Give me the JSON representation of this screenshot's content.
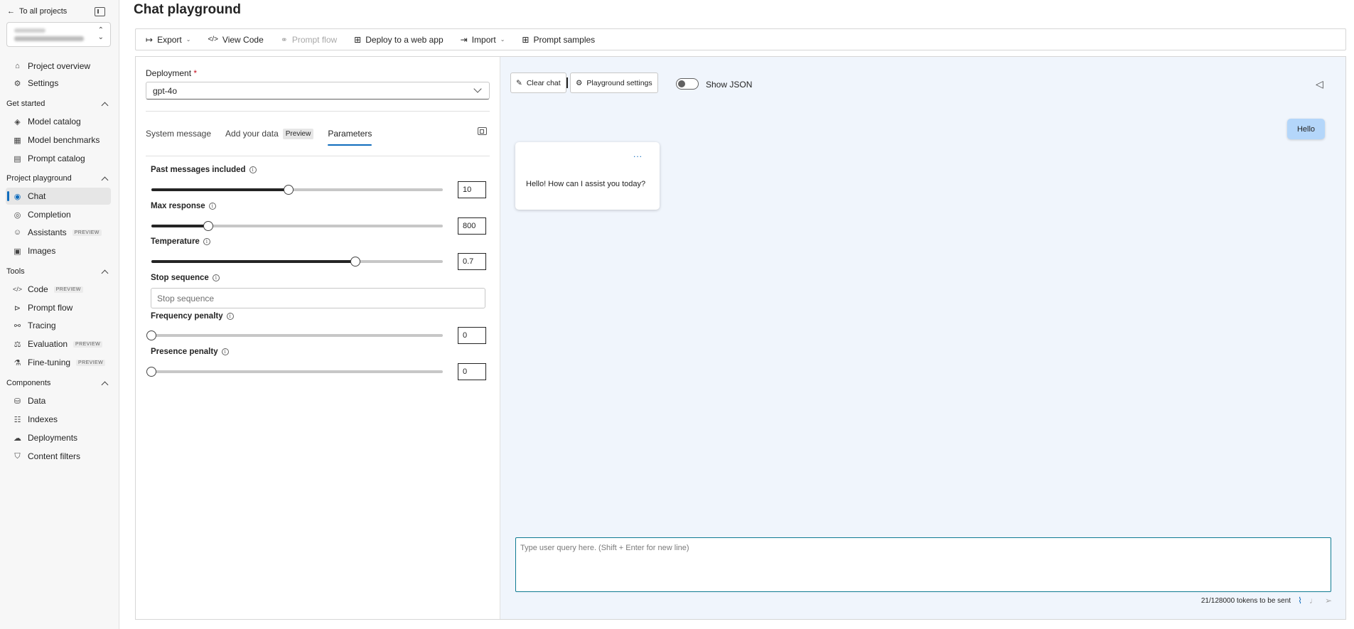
{
  "sidebar": {
    "back_label": "To all projects",
    "nav_top": [
      {
        "label": "Project overview",
        "icon": "⌂"
      },
      {
        "label": "Settings",
        "icon": "⚙"
      }
    ],
    "sections": [
      {
        "title": "Get started",
        "items": [
          {
            "label": "Model catalog",
            "icon": "◈"
          },
          {
            "label": "Model benchmarks",
            "icon": "▦"
          },
          {
            "label": "Prompt catalog",
            "icon": "▤"
          }
        ]
      },
      {
        "title": "Project playground",
        "items": [
          {
            "label": "Chat",
            "icon": "◉",
            "active": true
          },
          {
            "label": "Completion",
            "icon": "◎"
          },
          {
            "label": "Assistants",
            "icon": "☺",
            "badge": "PREVIEW"
          },
          {
            "label": "Images",
            "icon": "▣"
          }
        ]
      },
      {
        "title": "Tools",
        "items": [
          {
            "label": "Code",
            "icon": "</>",
            "badge": "PREVIEW"
          },
          {
            "label": "Prompt flow",
            "icon": "⊳"
          },
          {
            "label": "Tracing",
            "icon": "⚯"
          },
          {
            "label": "Evaluation",
            "icon": "⚖",
            "badge": "PREVIEW"
          },
          {
            "label": "Fine-tuning",
            "icon": "⚗",
            "badge": "PREVIEW"
          }
        ]
      },
      {
        "title": "Components",
        "items": [
          {
            "label": "Data",
            "icon": "⛁"
          },
          {
            "label": "Indexes",
            "icon": "☷"
          },
          {
            "label": "Deployments",
            "icon": "☁"
          },
          {
            "label": "Content filters",
            "icon": "⛉"
          }
        ]
      }
    ]
  },
  "page": {
    "title": "Chat playground"
  },
  "toolbar": {
    "export": "Export",
    "view_code": "View Code",
    "prompt_flow": "Prompt flow",
    "deploy": "Deploy to a web app",
    "import": "Import",
    "prompt_samples": "Prompt samples"
  },
  "setup": {
    "deployment_label": "Deployment",
    "required_mark": "*",
    "deployment_value": "gpt-4o",
    "tabs": {
      "system_message": "System message",
      "add_your_data": "Add your data",
      "preview_badge": "Preview",
      "parameters": "Parameters"
    },
    "params": {
      "past_messages": {
        "label": "Past messages included",
        "value": "10",
        "fraction": 0.47
      },
      "max_response": {
        "label": "Max response",
        "value": "800",
        "fraction": 0.195
      },
      "temperature": {
        "label": "Temperature",
        "value": "0.7",
        "fraction": 0.7
      },
      "stop_sequence": {
        "label": "Stop sequence",
        "placeholder": "Stop sequence"
      },
      "frequency_penalty": {
        "label": "Frequency penalty",
        "value": "0",
        "fraction": 0.0
      },
      "presence_penalty": {
        "label": "Presence penalty",
        "value": "0",
        "fraction": 0.0
      }
    }
  },
  "chat": {
    "clear_chat": "Clear chat",
    "playground_settings": "Playground settings",
    "show_json": "Show JSON",
    "show_json_on": false,
    "user_message": "Hello",
    "assistant_message": "Hello! How can I assist you today?",
    "more": "...",
    "input_placeholder": "Type user query here. (Shift + Enter for new line)",
    "token_count": "21/128000 tokens to be sent"
  },
  "colors": {
    "accent": "#0f6cbd",
    "chat_bg": "#f0f5fc",
    "user_bubble": "#b4d6fa",
    "input_border": "#0e7a92"
  }
}
